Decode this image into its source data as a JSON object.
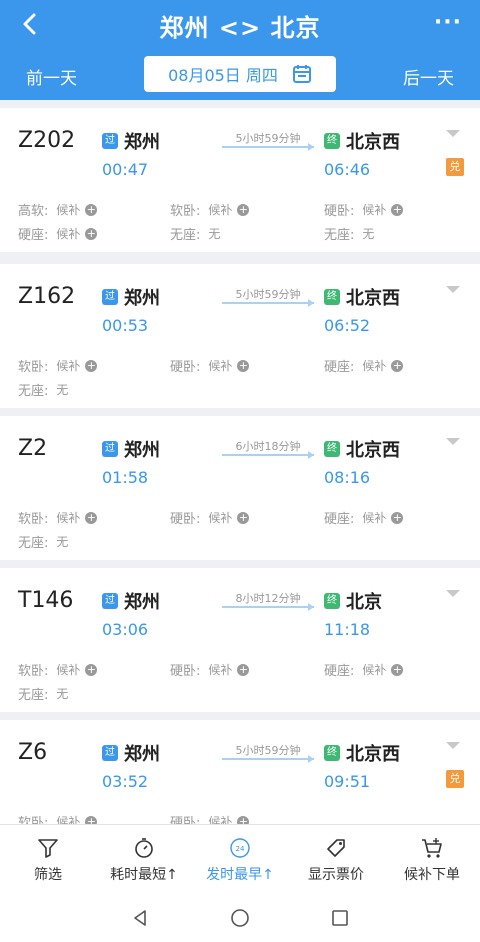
{
  "header": {
    "title": "郑州 <> 北京",
    "prev_day": "前一天",
    "next_day": "后一天",
    "date": "08月05日",
    "weekday": "周四",
    "more": "···",
    "back_icon": "chevron-left-icon",
    "calendar_icon": "calendar-icon",
    "color": "#3b97ec"
  },
  "labels": {
    "pass_tag": "过",
    "end_tag": "终",
    "exchange_badge": "兑",
    "pass_color": "#3b97ec",
    "end_color": "#3eb872",
    "badge_color": "#f29a3c"
  },
  "trains": [
    {
      "code": "Z202",
      "from": "郑州",
      "dep": "00:47",
      "duration": "5小时59分钟",
      "to": "北京西",
      "arr": "06:46",
      "badge": true,
      "seats": [
        {
          "name": "高软:",
          "value": "候补",
          "add": true
        },
        {
          "name": "软卧:",
          "value": "候补",
          "add": true
        },
        {
          "name": "硬卧:",
          "value": "候补",
          "add": true
        },
        {
          "name": "硬座:",
          "value": "候补",
          "add": true
        },
        {
          "name": "无座:",
          "value": "无",
          "add": false
        },
        {
          "name": "无座:",
          "value": "无",
          "add": false
        }
      ]
    },
    {
      "code": "Z162",
      "from": "郑州",
      "dep": "00:53",
      "duration": "5小时59分钟",
      "to": "北京西",
      "arr": "06:52",
      "badge": false,
      "seats": [
        {
          "name": "软卧:",
          "value": "候补",
          "add": true
        },
        {
          "name": "硬卧:",
          "value": "候补",
          "add": true
        },
        {
          "name": "硬座:",
          "value": "候补",
          "add": true
        },
        {
          "name": "无座:",
          "value": "无",
          "add": false
        }
      ]
    },
    {
      "code": "Z2",
      "from": "郑州",
      "dep": "01:58",
      "duration": "6小时18分钟",
      "to": "北京西",
      "arr": "08:16",
      "badge": false,
      "seats": [
        {
          "name": "软卧:",
          "value": "候补",
          "add": true
        },
        {
          "name": "硬卧:",
          "value": "候补",
          "add": true
        },
        {
          "name": "硬座:",
          "value": "候补",
          "add": true
        },
        {
          "name": "无座:",
          "value": "无",
          "add": false
        }
      ]
    },
    {
      "code": "T146",
      "from": "郑州",
      "dep": "03:06",
      "duration": "8小时12分钟",
      "to": "北京",
      "arr": "11:18",
      "badge": false,
      "seats": [
        {
          "name": "软卧:",
          "value": "候补",
          "add": true
        },
        {
          "name": "硬卧:",
          "value": "候补",
          "add": true
        },
        {
          "name": "硬座:",
          "value": "候补",
          "add": true
        },
        {
          "name": "无座:",
          "value": "无",
          "add": false
        }
      ]
    },
    {
      "code": "Z6",
      "from": "郑州",
      "dep": "03:52",
      "duration": "5小时59分钟",
      "to": "北京西",
      "arr": "09:51",
      "badge": true,
      "seats": [
        {
          "name": "软卧:",
          "value": "候补",
          "add": true
        },
        {
          "name": "硬卧:",
          "value": "候补",
          "add": true
        }
      ]
    }
  ],
  "tabbar": [
    {
      "label": "筛选",
      "icon": "filter-icon",
      "active": false
    },
    {
      "label": "耗时最短↑",
      "icon": "timer-icon",
      "active": false
    },
    {
      "label": "发时最早↑",
      "icon": "clock-24-icon",
      "active": true
    },
    {
      "label": "显示票价",
      "icon": "price-tag-icon",
      "active": false
    },
    {
      "label": "候补下单",
      "icon": "cart-plus-icon",
      "active": false
    }
  ],
  "navbar": [
    {
      "icon": "nav-back-icon"
    },
    {
      "icon": "nav-home-icon"
    },
    {
      "icon": "nav-recents-icon"
    }
  ]
}
